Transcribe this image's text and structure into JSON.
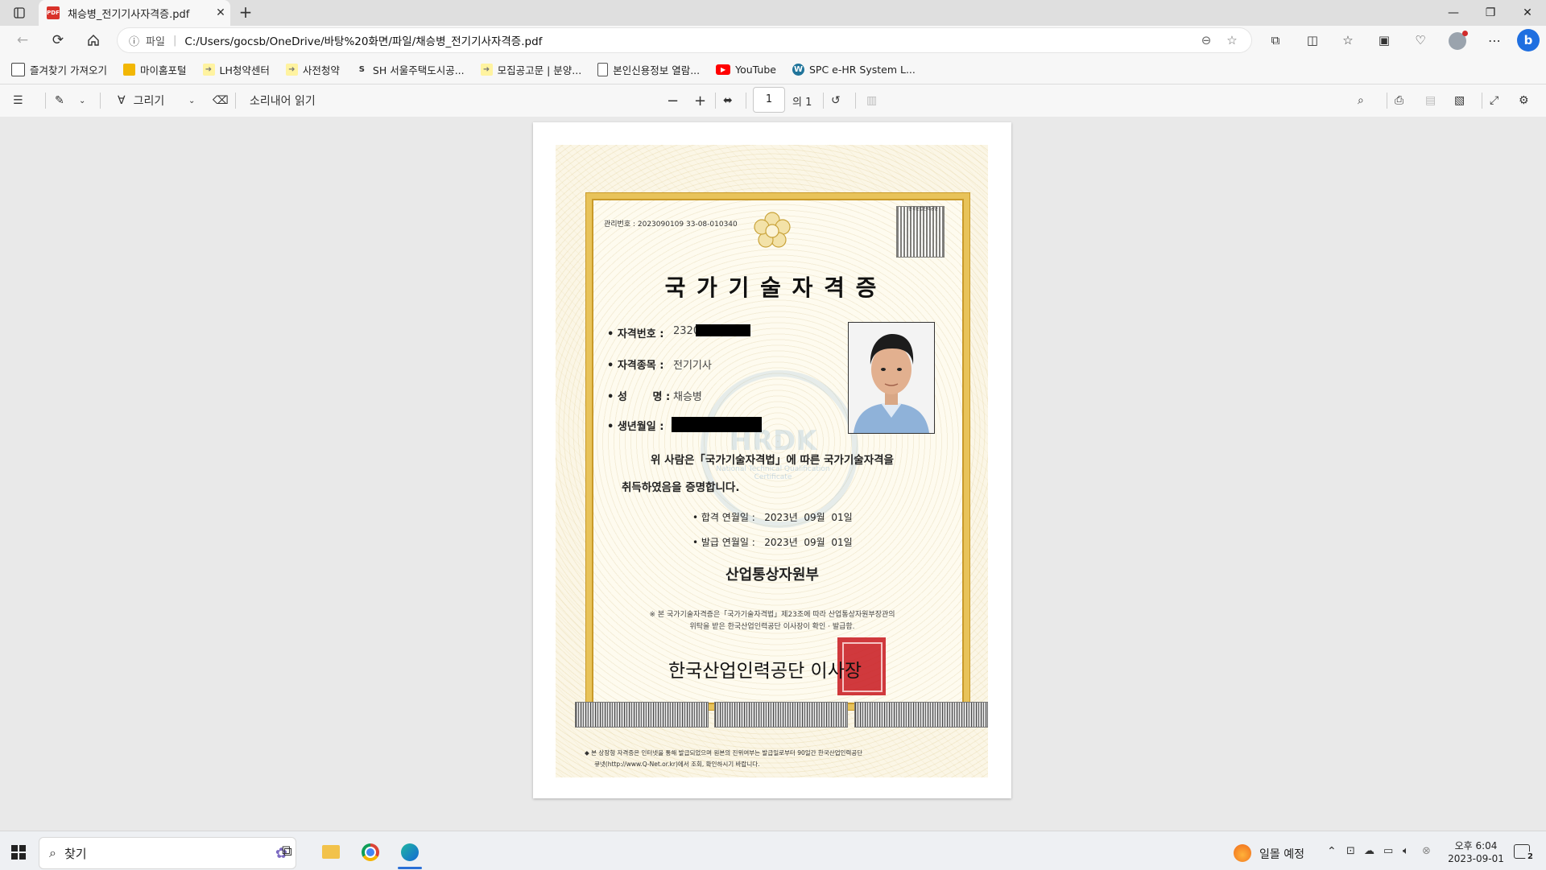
{
  "browser": {
    "tab_title": "채승병_전기기사자격증.pdf",
    "address_scheme": "파일",
    "address_url": "C:/Users/gocsb/OneDrive/바탕%20화면/파일/채승병_전기기사자격증.pdf"
  },
  "favorites": [
    {
      "label": "즐겨찾기 가져오기",
      "icon": "import-icon",
      "color": "#444444"
    },
    {
      "label": "마이홈포털",
      "icon": "home-folder-icon",
      "color": "#f2b705"
    },
    {
      "label": "LH청약센터",
      "icon": "arrow-bookmark-icon",
      "color": "#e0c200"
    },
    {
      "label": "사전청약",
      "icon": "arrow-bookmark-icon",
      "color": "#e0c200"
    },
    {
      "label": "SH 서울주택도시공...",
      "icon": "sh-logo-icon",
      "color": "#333333"
    },
    {
      "label": "모집공고문 | 분양...",
      "icon": "arrow-bookmark-icon",
      "color": "#e0c200"
    },
    {
      "label": "본인신용정보 열람...",
      "icon": "document-icon",
      "color": "#555555"
    },
    {
      "label": "YouTube",
      "icon": "youtube-icon",
      "color": "#ff0000"
    },
    {
      "label": "SPC e-HR System L...",
      "icon": "wordpress-icon",
      "color": "#21759b"
    }
  ],
  "pdf_toolbar": {
    "draw_label": "그리기",
    "read_aloud_label": "소리내어 읽기",
    "page_number": "1",
    "page_total": "의 1"
  },
  "certificate": {
    "management_no": "관리번호 : 2023090109 33-08-010340",
    "qr_caption": "한국산업인력공단",
    "title": "국 가 기 술 자 격 증",
    "fields": [
      {
        "label": "• 자격번호 :",
        "value": "2320"
      },
      {
        "label": "• 자격종목 :",
        "value": "전기기사"
      },
      {
        "label": "• 성       명 :",
        "value": "채승병"
      },
      {
        "label": "• 생년월일 :",
        "value": ""
      }
    ],
    "statement_line1": "위 사람은「국가기술자격법」에 따른 국가기술자격을",
    "statement_line2": "취득하였음을 증명합니다.",
    "pass_date": "• 합격 연월일 :   2023년  09월  01일",
    "issue_date": "• 발급 연월일 :   2023년  09월  01일",
    "ministry": "산업통상자원부",
    "note_line1": "※ 본 국가기술자격증은「국가기술자격법」제23조에 따라 산업통상자원부장관의",
    "note_line2": "위탁을 받은 한국산업인력공단 이사장이 확인 · 발급함.",
    "issuer": "한국산업인력공단 이사장",
    "watermark_text": "National Technical Qualification Certificate",
    "watermark_logo": "HRDK",
    "footer_line1": "◆ 본 상장형 자격증은 인터넷을 통해 발급되었으며 원본의 진위여부는 발급일로부터 90일간 한국산업인력공단",
    "footer_line2": "큐넷(http://www.Q-Net.or.kr)에서 조회, 확인하시기 바랍니다."
  },
  "taskbar": {
    "search_placeholder": "찾기",
    "weather_text": "일몰 예정",
    "time": "오후 6:04",
    "date": "2023-09-01",
    "notification_count": "2"
  }
}
